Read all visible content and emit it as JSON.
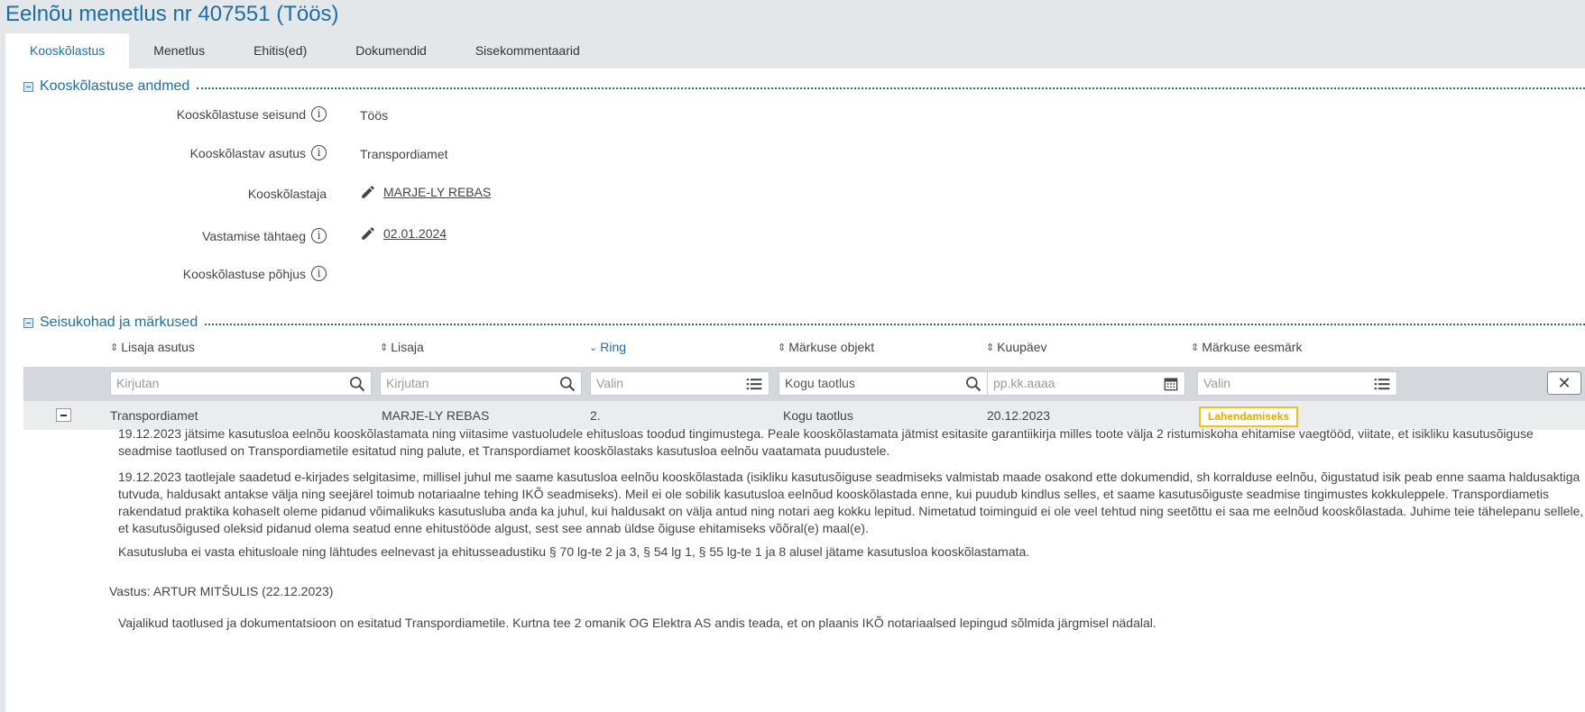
{
  "page": {
    "title": "Eelnõu menetlus nr 407551 (Töös)"
  },
  "tabs": [
    {
      "label": "Kooskõlastus",
      "active": true
    },
    {
      "label": "Menetlus"
    },
    {
      "label": "Ehitis(ed)"
    },
    {
      "label": "Dokumendid"
    },
    {
      "label": "Sisekommentaarid"
    }
  ],
  "section1": {
    "title": "Kooskõlastuse andmed",
    "fields": [
      {
        "label": "Kooskõlastuse seisund",
        "value": "Töös"
      },
      {
        "label": "Kooskõlastav asutus",
        "value": "Transpordiamet"
      },
      {
        "label": "Kooskõlastaja",
        "value": "MARJE-LY REBAS"
      },
      {
        "label": "Vastamise tähtaeg",
        "value": "02.01.2024"
      },
      {
        "label": "Kooskõlastuse põhjus",
        "value": ""
      }
    ]
  },
  "section2": {
    "title": "Seisukohad ja märkused",
    "columns": [
      "Lisaja asutus",
      "Lisaja",
      "Ring",
      "Märkuse objekt",
      "Kuupäev",
      "Märkuse eesmärk"
    ],
    "filters": [
      "Kirjutan",
      "Kirjutan",
      "Valin",
      "Kogu taotlus",
      "pp.kk.aaaa",
      "Valin"
    ],
    "row": {
      "asutus": "Transpordiamet",
      "lisaja": "MARJE-LY REBAS",
      "ring": "2.",
      "objekt": "Kogu taotlus",
      "kuupaev": "20.12.2023",
      "eesmark": "Lahendamiseks"
    },
    "paragraphs": [
      "19.12.2023 jätsime kasutusloa eelnõu kooskõlastamata ning viitasime vastuoludele ehitusloas toodud tingimustega. Peale kooskõlastamata jätmist esitasite garantiikirja milles toote välja 2 ristumiskoha ehitamise vaegtööd, viitate, et isikliku kasutusõiguse seadmise taotlused on Transpordiametile esitatud ning palute, et Transpordiamet kooskõlastaks kasutusloa eelnõu vaatamata puudustele.",
      "19.12.2023 taotlejale saadetud e-kirjades selgitasime, millisel juhul me saame kasutusloa eelnõu kooskõlastada (isikliku kasutusõiguse seadmiseks valmistab maade osakond ette dokumendid, sh korralduse eelnõu, õigustatud isik peab enne saama haldusaktiga tutvuda, haldusakt antakse välja ning seejärel toimub notariaalne tehing IKÕ seadmiseks). Meil ei ole sobilik kasutusloa eelnõud kooskõlastada enne, kui puudub kindlus selles, et saame kasutusõiguste seadmise tingimustes kokkuleppele. Transpordiametis rakendatud praktika kohaselt oleme pidanud võimalikuks kasutusluba anda ka juhul, kui haldusakt on välja antud ning notari aeg kokku lepitud. Nimetatud toiminguid ei ole veel tehtud ning seetõttu ei saa me eelnõud kooskõlastada. Juhime teie tähelepanu sellele, et kasutusõigused oleksid pidanud olema seatud enne ehitustööde algust, sest see annab üldse õiguse ehitamiseks võõral(e) maal(e).",
      "Kasutusluba ei vasta ehitusloale ning lähtudes eelnevast ja ehitusseadustiku § 70 lg-te 2 ja 3, § 54 lg 1, § 55 lg-te 1 ja 8 alusel jätame kasutusloa kooskõlastamata."
    ],
    "answer_head": "Vastus: ARTUR MITŠULIS (22.12.2023)",
    "answer_text": "Vajalikud taotlused ja dokumentatsioon on esitatud Transpordiametile. Kurtna tee 2 omanik OG Elektra AS andis teada, et on plaanis IKÕ notariaalsed lepingud sõlmida järgmisel nädalal."
  },
  "colors": {
    "accent": "#1c6ea4",
    "badge": "#f2c21b",
    "ok": "#5cb85c"
  }
}
